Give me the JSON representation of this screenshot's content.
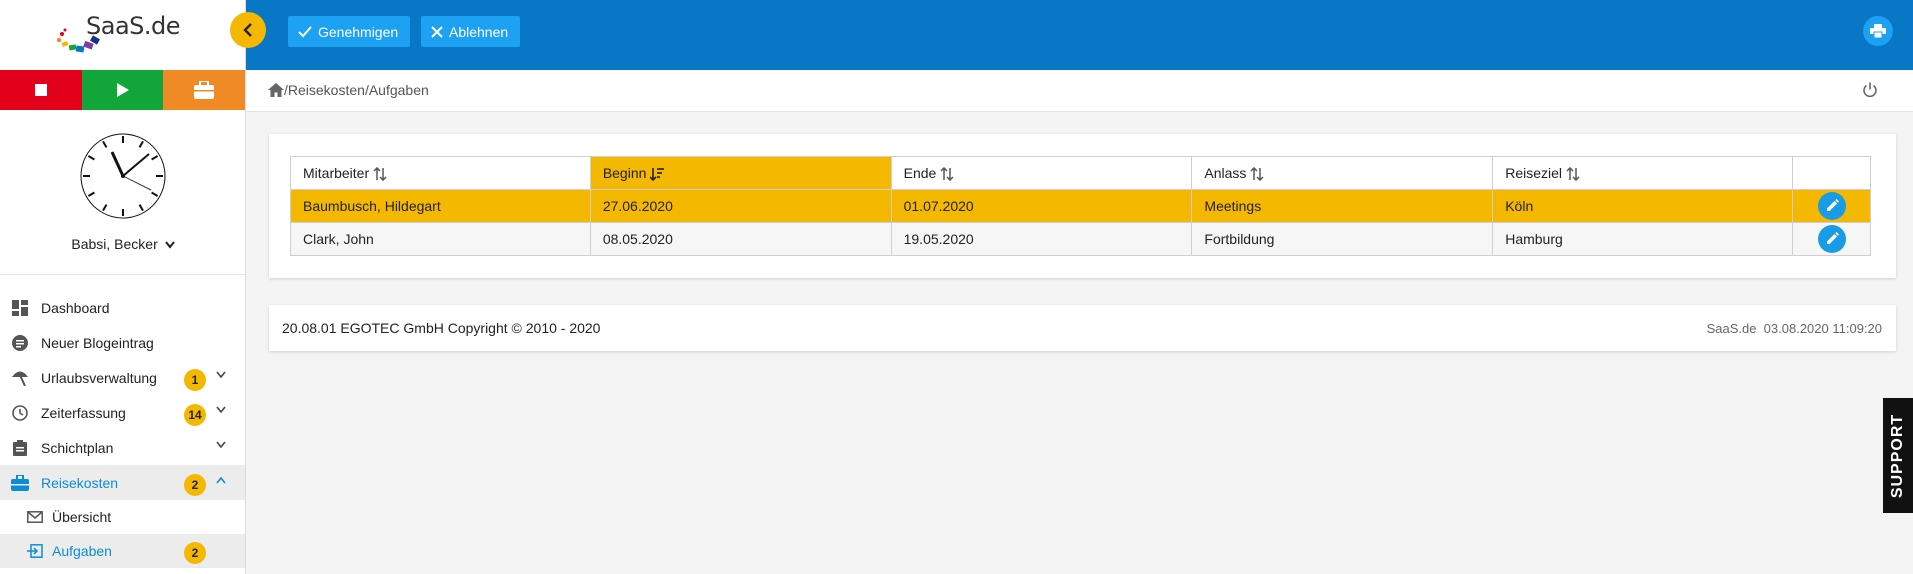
{
  "brand": {
    "logo_text": "SaaS.de"
  },
  "user": {
    "name": "Babsi, Becker"
  },
  "sidebar": {
    "items": [
      {
        "label": "Dashboard"
      },
      {
        "label": "Neuer Blogeintrag"
      },
      {
        "label": "Urlaubsverwaltung",
        "badge": "1"
      },
      {
        "label": "Zeiterfassung",
        "badge": "14"
      },
      {
        "label": "Schichtplan"
      },
      {
        "label": "Reisekosten",
        "badge": "2"
      }
    ],
    "subitems": [
      {
        "label": "Übersicht"
      },
      {
        "label": "Aufgaben",
        "badge": "2"
      }
    ]
  },
  "toolbar": {
    "approve_label": "Genehmigen",
    "reject_label": "Ablehnen"
  },
  "breadcrumb": {
    "sep1": "/",
    "part1": "Reisekosten",
    "sep2": "/",
    "part2": "Aufgaben"
  },
  "table": {
    "headers": [
      "Mitarbeiter",
      "Beginn",
      "Ende",
      "Anlass",
      "Reiseziel"
    ],
    "rows": [
      [
        "Baumbusch, Hildegart",
        "27.06.2020",
        "01.07.2020",
        "Meetings",
        "Köln"
      ],
      [
        "Clark, John",
        "08.05.2020",
        "19.05.2020",
        "Fortbildung",
        "Hamburg"
      ]
    ]
  },
  "footer": {
    "left": "20.08.01 EGOTEC GmbH Copyright © 2010 - 2020",
    "right": "SaaS.de  03.08.2020 11:09:20"
  },
  "support_label": "SUPPORT",
  "colors": {
    "accent": "#f5b800",
    "primary": "#0878c6",
    "button": "#1da1f2",
    "stop": "#e3001b",
    "play": "#11a53a",
    "case": "#f08a24"
  }
}
